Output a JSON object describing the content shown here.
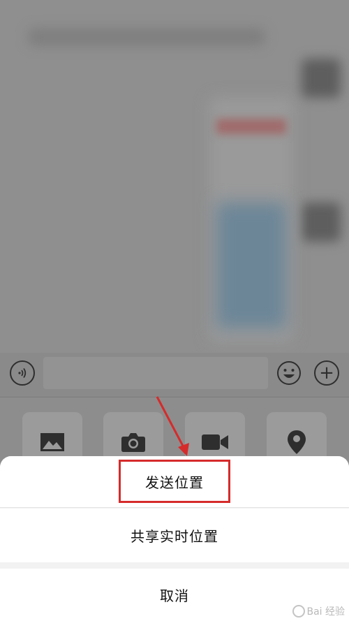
{
  "action_sheet": {
    "send_location": "发送位置",
    "share_live_location": "共享实时位置",
    "cancel": "取消"
  },
  "toolbar": {
    "tools": [
      {
        "icon": "image-icon"
      },
      {
        "icon": "camera-icon"
      },
      {
        "icon": "video-call-icon"
      },
      {
        "icon": "location-pin-icon"
      }
    ]
  },
  "input_bar": {
    "icons": [
      "voice-icon",
      "emoji-icon",
      "plus-icon"
    ]
  },
  "annotation": {
    "color": "#d62b2b"
  },
  "watermark": {
    "text": "Bai 经验"
  }
}
